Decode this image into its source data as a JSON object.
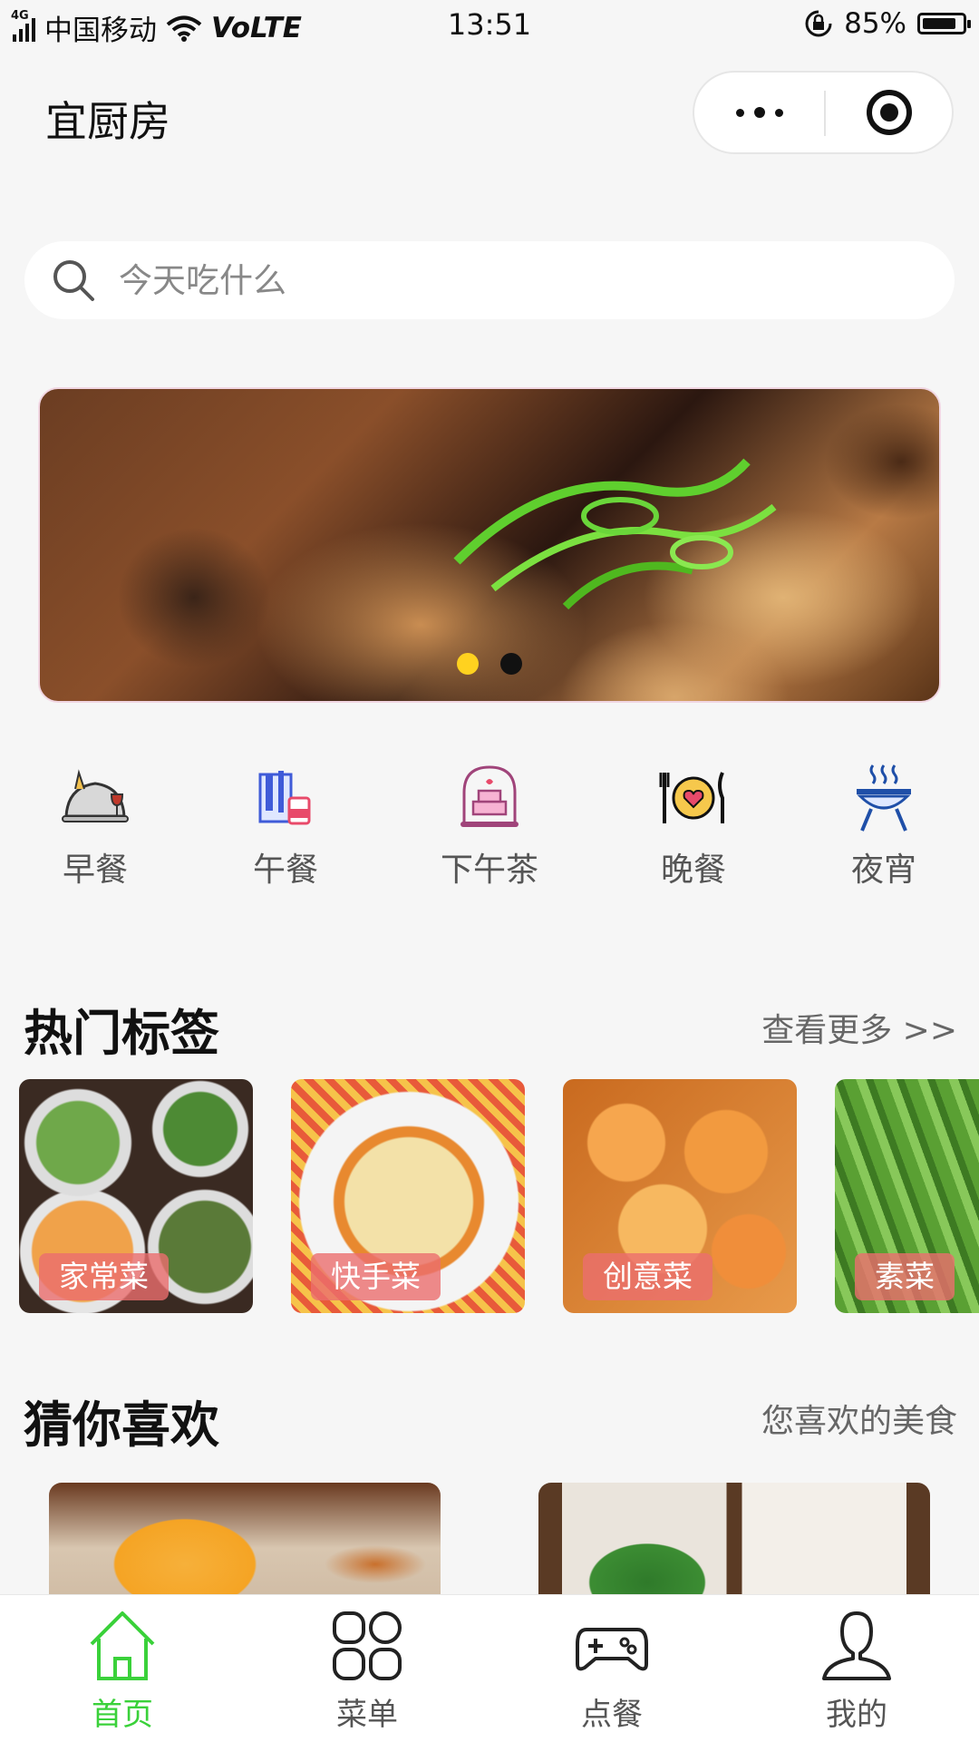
{
  "status_bar": {
    "network_badge": "4G",
    "carrier": "中国移动",
    "volte": "VoLTE",
    "time": "13:51",
    "battery": "85%",
    "battery_level": 0.85
  },
  "header": {
    "title": "宜厨房"
  },
  "search": {
    "placeholder": "今天吃什么"
  },
  "banner": {
    "slide_count": 2,
    "active_slide": 0
  },
  "categories": [
    {
      "label": "早餐",
      "icon": "breakfast-cloche-icon"
    },
    {
      "label": "午餐",
      "icon": "lunch-drink-icon"
    },
    {
      "label": "下午茶",
      "icon": "cake-dome-icon"
    },
    {
      "label": "晚餐",
      "icon": "dinner-plate-icon"
    },
    {
      "label": "夜宵",
      "icon": "barbecue-grill-icon"
    }
  ],
  "hot_tags": {
    "title": "热门标签",
    "more": "查看更多 >>",
    "items": [
      {
        "label": "家常菜"
      },
      {
        "label": "快手菜"
      },
      {
        "label": "创意菜"
      },
      {
        "label": "素菜"
      }
    ]
  },
  "guess": {
    "title": "猜你喜欢",
    "subtitle": "您喜欢的美食"
  },
  "tab_bar": {
    "active_color": "#3ad13a",
    "items": [
      {
        "label": "首页",
        "icon": "home-icon",
        "active": true
      },
      {
        "label": "菜单",
        "icon": "grid-menu-icon",
        "active": false
      },
      {
        "label": "点餐",
        "icon": "gamepad-icon",
        "active": false
      },
      {
        "label": "我的",
        "icon": "user-icon",
        "active": false
      }
    ]
  }
}
